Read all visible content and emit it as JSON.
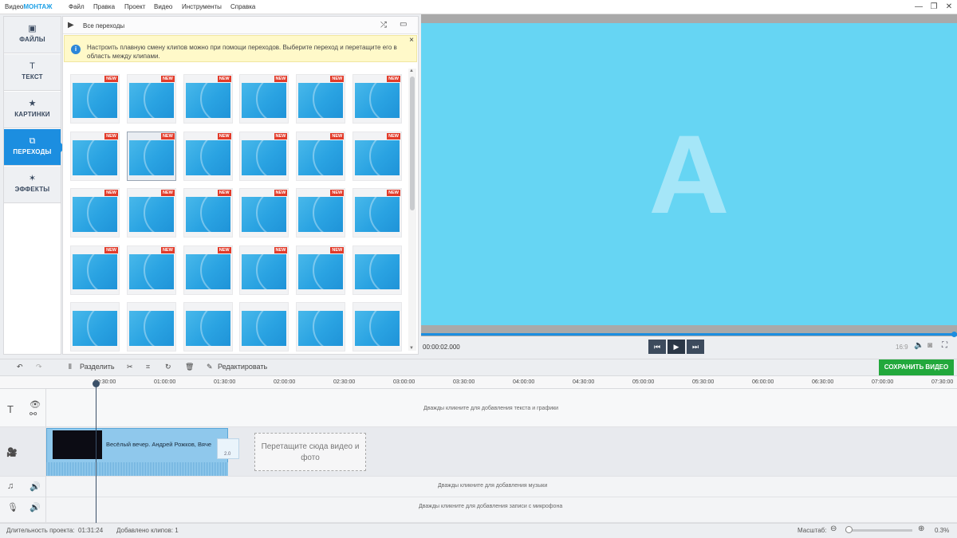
{
  "app": {
    "logo_prefix": "Видео",
    "logo_brand": "МОНТАЖ"
  },
  "menu": [
    "Файл",
    "Правка",
    "Проект",
    "Видео",
    "Инструменты",
    "Справка"
  ],
  "window_controls": {
    "minimize": "—",
    "maximize": "❐",
    "close": "✕"
  },
  "sidebar": {
    "items": [
      {
        "label": "ФАЙЛЫ",
        "icon": "image-icon",
        "glyph": "▣"
      },
      {
        "label": "ТЕКСТ",
        "icon": "text-icon",
        "glyph": "T"
      },
      {
        "label": "КАРТИНКИ",
        "icon": "star-icon",
        "glyph": "★"
      },
      {
        "label": "ПЕРЕХОДЫ",
        "icon": "transitions-icon",
        "glyph": "⧉",
        "active": true
      },
      {
        "label": "ЭФФЕКТЫ",
        "icon": "magic-wand-icon",
        "glyph": "✶"
      }
    ]
  },
  "panel": {
    "title": "Все переходы",
    "tip": "Настроить плавную смену клипов можно при помощи переходов. Выберите переход и перетащите его в область между клипами.",
    "new_badge": "NEW",
    "thumbs_new": [
      true,
      true,
      true,
      true,
      true,
      true,
      true,
      true,
      true,
      true,
      true,
      true,
      true,
      true,
      true,
      true,
      true,
      true,
      true,
      true,
      true,
      true,
      true,
      false,
      false,
      false,
      false,
      false,
      false,
      false
    ],
    "selected_index": 7
  },
  "preview": {
    "letter": "A",
    "time": "00:00:02.000",
    "ratio": "16:9"
  },
  "toolbar": {
    "split": "Разделить",
    "edit": "Редактировать",
    "save": "СОХРАНИТЬ ВИДЕО"
  },
  "ruler": [
    "00:30:00",
    "01:00:00",
    "01:30:00",
    "02:00:00",
    "02:30:00",
    "03:00:00",
    "03:30:00",
    "04:00:00",
    "04:30:00",
    "05:00:00",
    "05:30:00",
    "06:00:00",
    "06:30:00",
    "07:00:00",
    "07:30:00"
  ],
  "timeline": {
    "text_lane": "Дважды кликните для добавления текста и графики",
    "clip_title": "Весёлый вечер. Андрей Рожков, Вяче",
    "transition_duration": "2.0",
    "dropzone": "Перетащите сюда видео и фото",
    "music_lane": "Дважды кликните для добавления музыки",
    "mic_lane": "Дважды кликните для добавления записи с микрофона"
  },
  "status": {
    "duration_label": "Длительность проекта:",
    "duration": "01:31:24",
    "clips": "Добавлено клипов: 1",
    "zoom_label": "Масштаб:",
    "zoom": "0.3%",
    "zoom_level": 0.03
  },
  "colors": {
    "accent": "#1c8ee0",
    "save": "#22a83c",
    "preview_bg": "#66d5f3",
    "new_badge": "#e23b2a"
  }
}
